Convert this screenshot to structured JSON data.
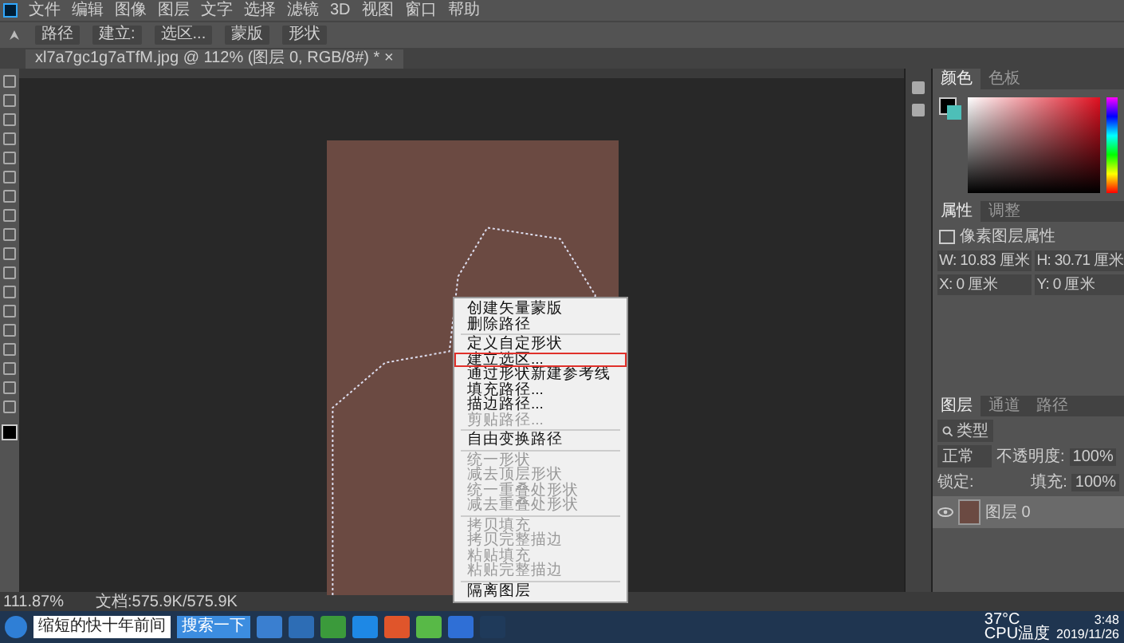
{
  "menu_bar": [
    "文件",
    "编辑",
    "图像",
    "图层",
    "文字",
    "选择",
    "滤镜",
    "3D",
    "视图",
    "窗口",
    "帮助"
  ],
  "options_bar": {
    "items": [
      "路径",
      "建立:",
      "选区...",
      "蒙版",
      "形状"
    ]
  },
  "document_tab": {
    "title": "xl7a7gc1g7aTfM.jpg @ 112% (图层 0, RGB/8#) *",
    "close": "×"
  },
  "context_menu": {
    "groups": [
      [
        {
          "label": "创建矢量蒙版",
          "disabled": false,
          "selected": false
        },
        {
          "label": "删除路径",
          "disabled": false,
          "selected": false
        }
      ],
      [
        {
          "label": "定义自定形状",
          "disabled": false,
          "selected": false
        },
        {
          "label": "建立选区...",
          "disabled": false,
          "selected": true
        },
        {
          "label": "通过形状新建参考线",
          "disabled": false,
          "selected": false
        },
        {
          "label": "填充路径...",
          "disabled": false,
          "selected": false
        },
        {
          "label": "描边路径...",
          "disabled": false,
          "selected": false
        },
        {
          "label": "剪贴路径...",
          "disabled": true,
          "selected": false
        }
      ],
      [
        {
          "label": "自由变换路径",
          "disabled": false,
          "selected": false
        }
      ],
      [
        {
          "label": "统一形状",
          "disabled": true,
          "selected": false
        },
        {
          "label": "减去顶层形状",
          "disabled": true,
          "selected": false
        },
        {
          "label": "统一重叠处形状",
          "disabled": true,
          "selected": false
        },
        {
          "label": "减去重叠处形状",
          "disabled": true,
          "selected": false
        }
      ],
      [
        {
          "label": "拷贝填充",
          "disabled": true,
          "selected": false
        },
        {
          "label": "拷贝完整描边",
          "disabled": true,
          "selected": false
        },
        {
          "label": "粘贴填充",
          "disabled": true,
          "selected": false
        },
        {
          "label": "粘贴完整描边",
          "disabled": true,
          "selected": false
        }
      ],
      [
        {
          "label": "隔离图层",
          "disabled": false,
          "selected": false
        }
      ]
    ]
  },
  "color_panel": {
    "tabs": [
      {
        "label": "颜色",
        "selected": true
      },
      {
        "label": "色板",
        "selected": false
      }
    ]
  },
  "properties_panel": {
    "tabs": [
      {
        "label": "属性",
        "selected": true
      },
      {
        "label": "调整",
        "selected": false
      }
    ],
    "title": "像素图层属性",
    "fields": [
      {
        "label": "W:",
        "value": "10.83 厘米"
      },
      {
        "label": "H:",
        "value": "30.71 厘米"
      },
      {
        "label": "X:",
        "value": "0 厘米"
      },
      {
        "label": "Y:",
        "value": "0 厘米"
      }
    ]
  },
  "layers_panel": {
    "tabs": [
      {
        "label": "图层",
        "selected": true
      },
      {
        "label": "通道",
        "selected": false
      },
      {
        "label": "路径",
        "selected": false
      }
    ],
    "filter": "类型",
    "blend_mode": "正常",
    "opacity_label": "不透明度:",
    "opacity": "100%",
    "lock_label": "锁定:",
    "fill_label": "填充:",
    "fill": "100%",
    "layers": [
      {
        "name": "图层 0",
        "visible": true,
        "selected": true
      }
    ]
  },
  "status_bar": {
    "zoom": "111.87%",
    "document": "文档:575.9K/575.9K"
  },
  "taskbar": {
    "search_text": "缩短的快十年前间",
    "search_button": "搜索一下",
    "tray": [
      "37°C",
      "CPU温度"
    ],
    "time": "3:48",
    "date": "2019/11/26"
  }
}
